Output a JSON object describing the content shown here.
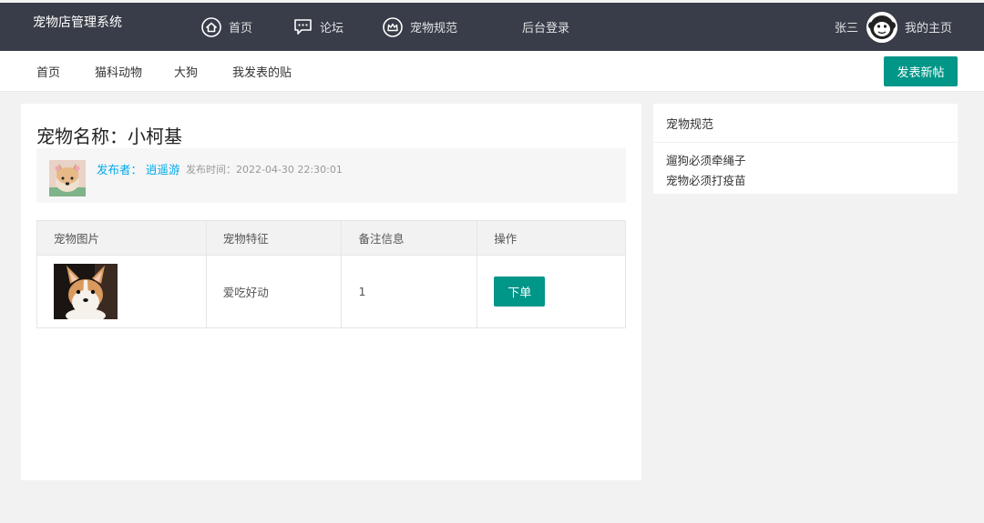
{
  "header": {
    "brand": "宠物店管理系统",
    "nav": [
      {
        "label": "首页",
        "icon": "home-icon"
      },
      {
        "label": "论坛",
        "icon": "chat-icon"
      },
      {
        "label": "宠物规范",
        "icon": "crown-icon"
      },
      {
        "label": "后台登录",
        "icon": ""
      }
    ],
    "user_name": "张三",
    "my_home": "我的主页"
  },
  "subnav": {
    "items": [
      "首页",
      "猫科动物",
      "大狗",
      "我发表的贴"
    ],
    "post_button": "发表新帖"
  },
  "post": {
    "title": "宠物名称：小柯基",
    "publisher_label": "发布者：",
    "publisher_name": "逍遥游",
    "publish_time": "发布时间：2022-04-30 22:30:01"
  },
  "table": {
    "headers": [
      "宠物图片",
      "宠物特征",
      "备注信息",
      "操作"
    ],
    "rows": [
      {
        "feature": "爱吃好动",
        "note": "1",
        "action": "下单"
      }
    ]
  },
  "sidebar": {
    "title": "宠物规范",
    "rules": [
      "遛狗必须牵绳子",
      "宠物必须打疫苗"
    ]
  },
  "colors": {
    "header_bg": "#393d49",
    "accent": "#009688",
    "link": "#01aaed"
  }
}
